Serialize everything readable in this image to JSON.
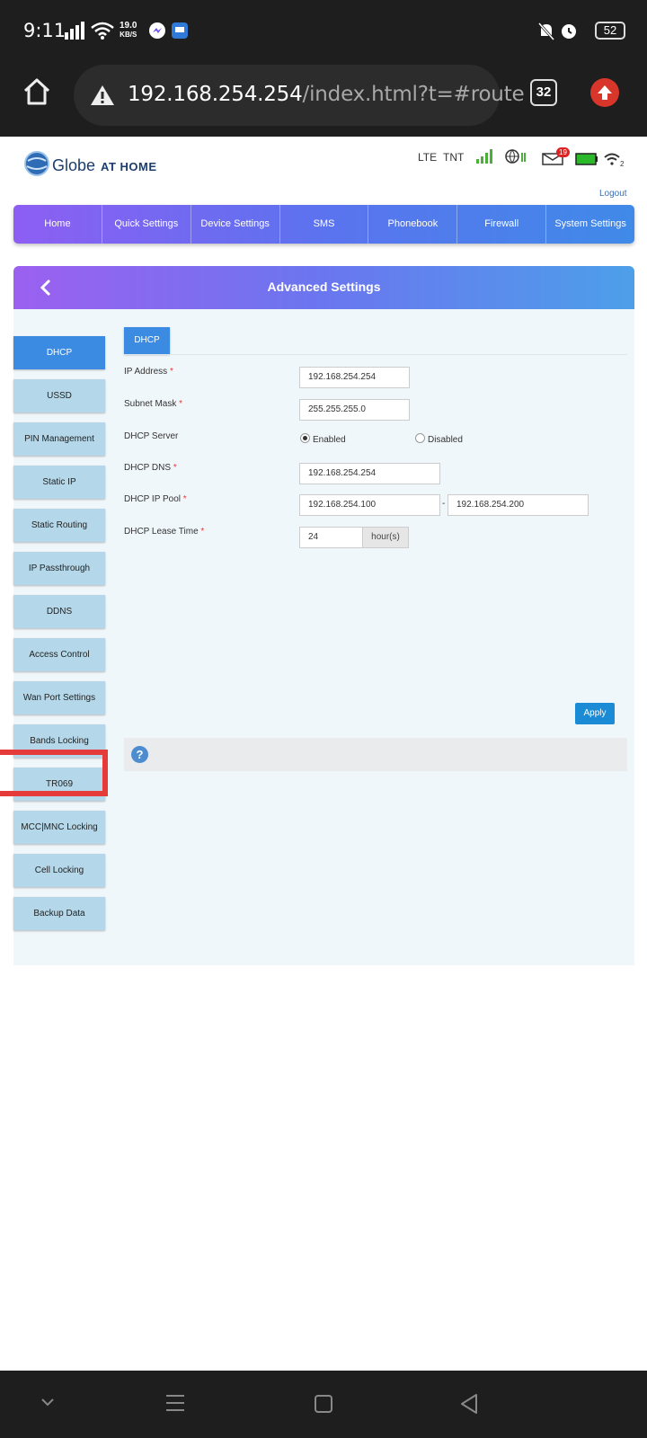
{
  "status_bar": {
    "time": "9:11",
    "speed_value": "19.0",
    "speed_unit": "KB/S",
    "battery": "52"
  },
  "browser": {
    "url_host": "192.168.254.254",
    "url_path": "/index.html?t=#route",
    "tab_count": "32"
  },
  "header": {
    "brand": "Globe",
    "brand_suffix": "AT HOME",
    "network_type": "LTE",
    "carrier": "TNT",
    "sms_badge": "19",
    "wifi_clients": "2",
    "logout": "Logout"
  },
  "nav": {
    "items": [
      "Home",
      "Quick Settings",
      "Device Settings",
      "SMS",
      "Phonebook",
      "Firewall",
      "System Settings"
    ]
  },
  "panel": {
    "title": "Advanced Settings"
  },
  "sidebar": {
    "items": [
      "DHCP",
      "USSD",
      "PIN Management",
      "Static IP",
      "Static Routing",
      "IP Passthrough",
      "DDNS",
      "Access Control",
      "Wan Port Settings",
      "Bands Locking",
      "TR069",
      "MCC|MNC Locking",
      "Cell Locking",
      "Backup Data"
    ]
  },
  "form": {
    "tab": "DHCP",
    "ip_address_label": "IP Address",
    "ip_address": "192.168.254.254",
    "subnet_mask_label": "Subnet Mask",
    "subnet_mask": "255.255.255.0",
    "dhcp_server_label": "DHCP Server",
    "enabled": "Enabled",
    "disabled": "Disabled",
    "dhcp_dns_label": "DHCP DNS",
    "dhcp_dns": "192.168.254.254",
    "ip_pool_label": "DHCP IP Pool",
    "pool_start": "192.168.254.100",
    "pool_sep": "-",
    "pool_end": "192.168.254.200",
    "lease_label": "DHCP Lease Time",
    "lease": "24",
    "lease_unit": "hour(s)",
    "required_mark": "*",
    "apply": "Apply",
    "help": "?"
  }
}
